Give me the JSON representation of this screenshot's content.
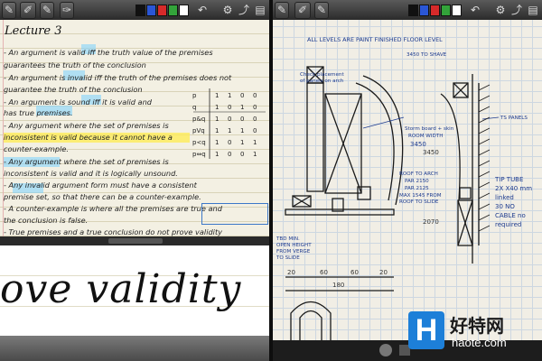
{
  "left_note": {
    "title": "Lecture 3",
    "lines": [
      "- An argument is valid iff the truth value of the premises",
      "  guarantees the truth of the conclusion",
      "- An argument is invalid iff the truth of the premises does not",
      "  guarantee the truth of the conclusion",
      "- An argument is sound iff it is valid and",
      "  has true premises.",
      "- Any argument where the set of premises is",
      "  inconsistent is valid because it cannot have a",
      "  counter-example.",
      "- Any argument where the set of premises is",
      "  inconsistent is valid and it is logically unsound.",
      "- Any invalid argument form must have a consistent",
      "  premise set, so that there can be a counter-example.",
      "- A counter-example is where all the premises are true and",
      "  the conclusion is false.",
      "- True premises and a true conclusion do not prove validity"
    ],
    "truth_table": {
      "rows": [
        [
          "p",
          "1",
          "1",
          "0",
          "0"
        ],
        [
          "q",
          "1",
          "0",
          "1",
          "0"
        ],
        [
          "p&q",
          "1",
          "0",
          "0",
          "0"
        ],
        [
          "pVq",
          "1",
          "1",
          "1",
          "0"
        ],
        [
          "p<q",
          "1",
          "0",
          "1",
          "1"
        ],
        [
          "p⇔q",
          "1",
          "0",
          "0",
          "1"
        ]
      ]
    },
    "zoom_text": "ove validity"
  },
  "right_note": {
    "heading": "ALL LEVELS ARE PAINT FINISHED FLOOR LEVEL",
    "level_label": "3450 TO SHAVE",
    "labels": [
      "Check placement",
      "of panels on arch",
      "Storm board + skin",
      "ROOM WIDTH",
      "3450",
      "ROOF TO ARCH",
      "PAR 2150",
      "PAR 2125",
      "MAX 1545 FROM",
      "ROOF TO SLIDE",
      "TBD MIN.",
      "OPEN HEIGHT",
      "FROM VERGE",
      "TO SLIDE",
      "TS PANELS",
      "TIP TUBE",
      "2X X40 mm",
      "linked",
      "30 NO",
      "CABLE no",
      "required"
    ],
    "dims": [
      "20",
      "60",
      "60",
      "20",
      "180",
      "2070",
      "3450"
    ]
  },
  "toolbar": {
    "icons": [
      "wrench-icon",
      "pen-icon",
      "eraser-icon",
      "undo-icon",
      "gear-icon",
      "share-icon",
      "page-icon"
    ],
    "colors": [
      "#111111",
      "#2a56d6",
      "#d62a2a",
      "#33a33a",
      "#ffffff"
    ]
  },
  "watermark": {
    "letter": "H",
    "name": "好特网",
    "url": "haote.com"
  },
  "colors": {
    "highlight_blue": "#78d2ff",
    "highlight_yellow": "#ffec50",
    "ink_blue": "#1d3b8f",
    "watermark_blue": "#1d7fd8"
  }
}
